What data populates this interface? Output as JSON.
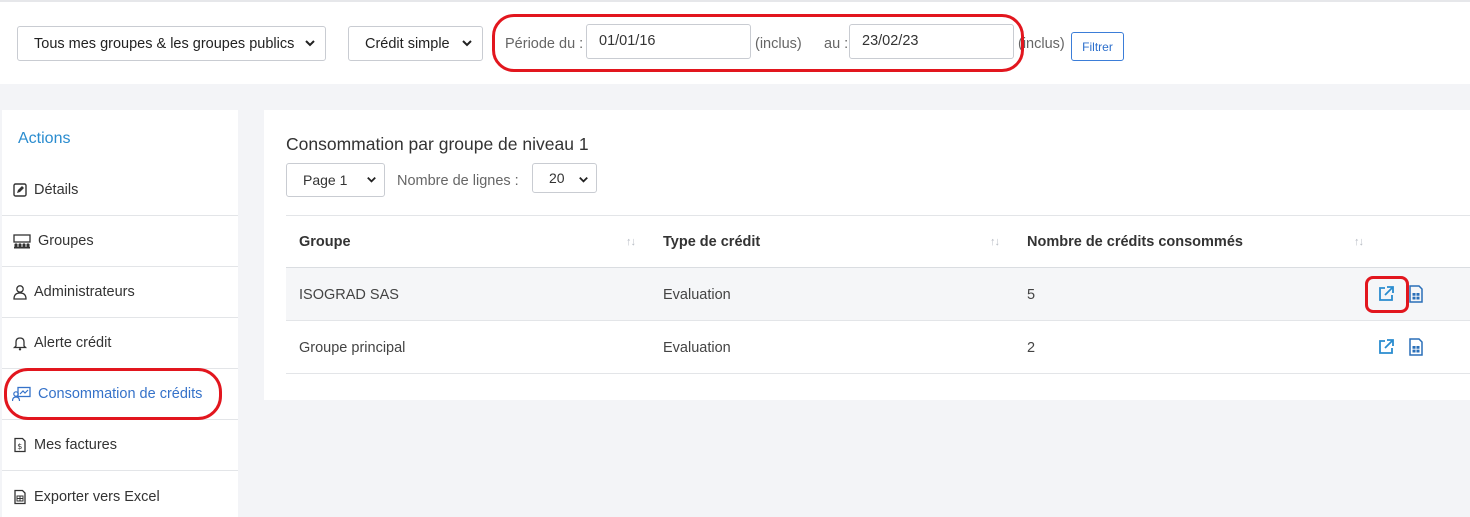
{
  "filters": {
    "group_select": "Tous mes groupes & les groupes publics",
    "credit_select": "Crédit simple",
    "period_label": "Période du :",
    "date_from": "01/01/16",
    "inclusive_1": "(inclus)",
    "to_label": "au :",
    "date_to": "23/02/23",
    "inclusive_2": "(inclus)",
    "filter_button": "Filtrer"
  },
  "sidebar": {
    "title": "Actions",
    "items": [
      {
        "label": "Détails",
        "icon": "edit-icon"
      },
      {
        "label": "Groupes",
        "icon": "groups-icon"
      },
      {
        "label": "Administrateurs",
        "icon": "user-icon"
      },
      {
        "label": "Alerte crédit",
        "icon": "bell-icon"
      },
      {
        "label": "Consommation de crédits",
        "icon": "chart-user-icon",
        "active": true
      },
      {
        "label": "Mes factures",
        "icon": "invoice-icon"
      },
      {
        "label": "Exporter vers Excel",
        "icon": "excel-icon"
      }
    ]
  },
  "panel": {
    "title": "Consommation par groupe de niveau 1",
    "page_select": "Page 1",
    "lines_label": "Nombre de lignes :",
    "lines_select": "20"
  },
  "table": {
    "columns": [
      "Groupe",
      "Type de crédit",
      "Nombre de crédits consommés"
    ],
    "rows": [
      [
        "ISOGRAD SAS",
        "Evaluation",
        "5"
      ],
      [
        "Groupe principal",
        "Evaluation",
        "2"
      ]
    ]
  },
  "colors": {
    "accent": "#2a8ccf",
    "active_link": "#3572c9",
    "highlight": "#e2161e"
  }
}
